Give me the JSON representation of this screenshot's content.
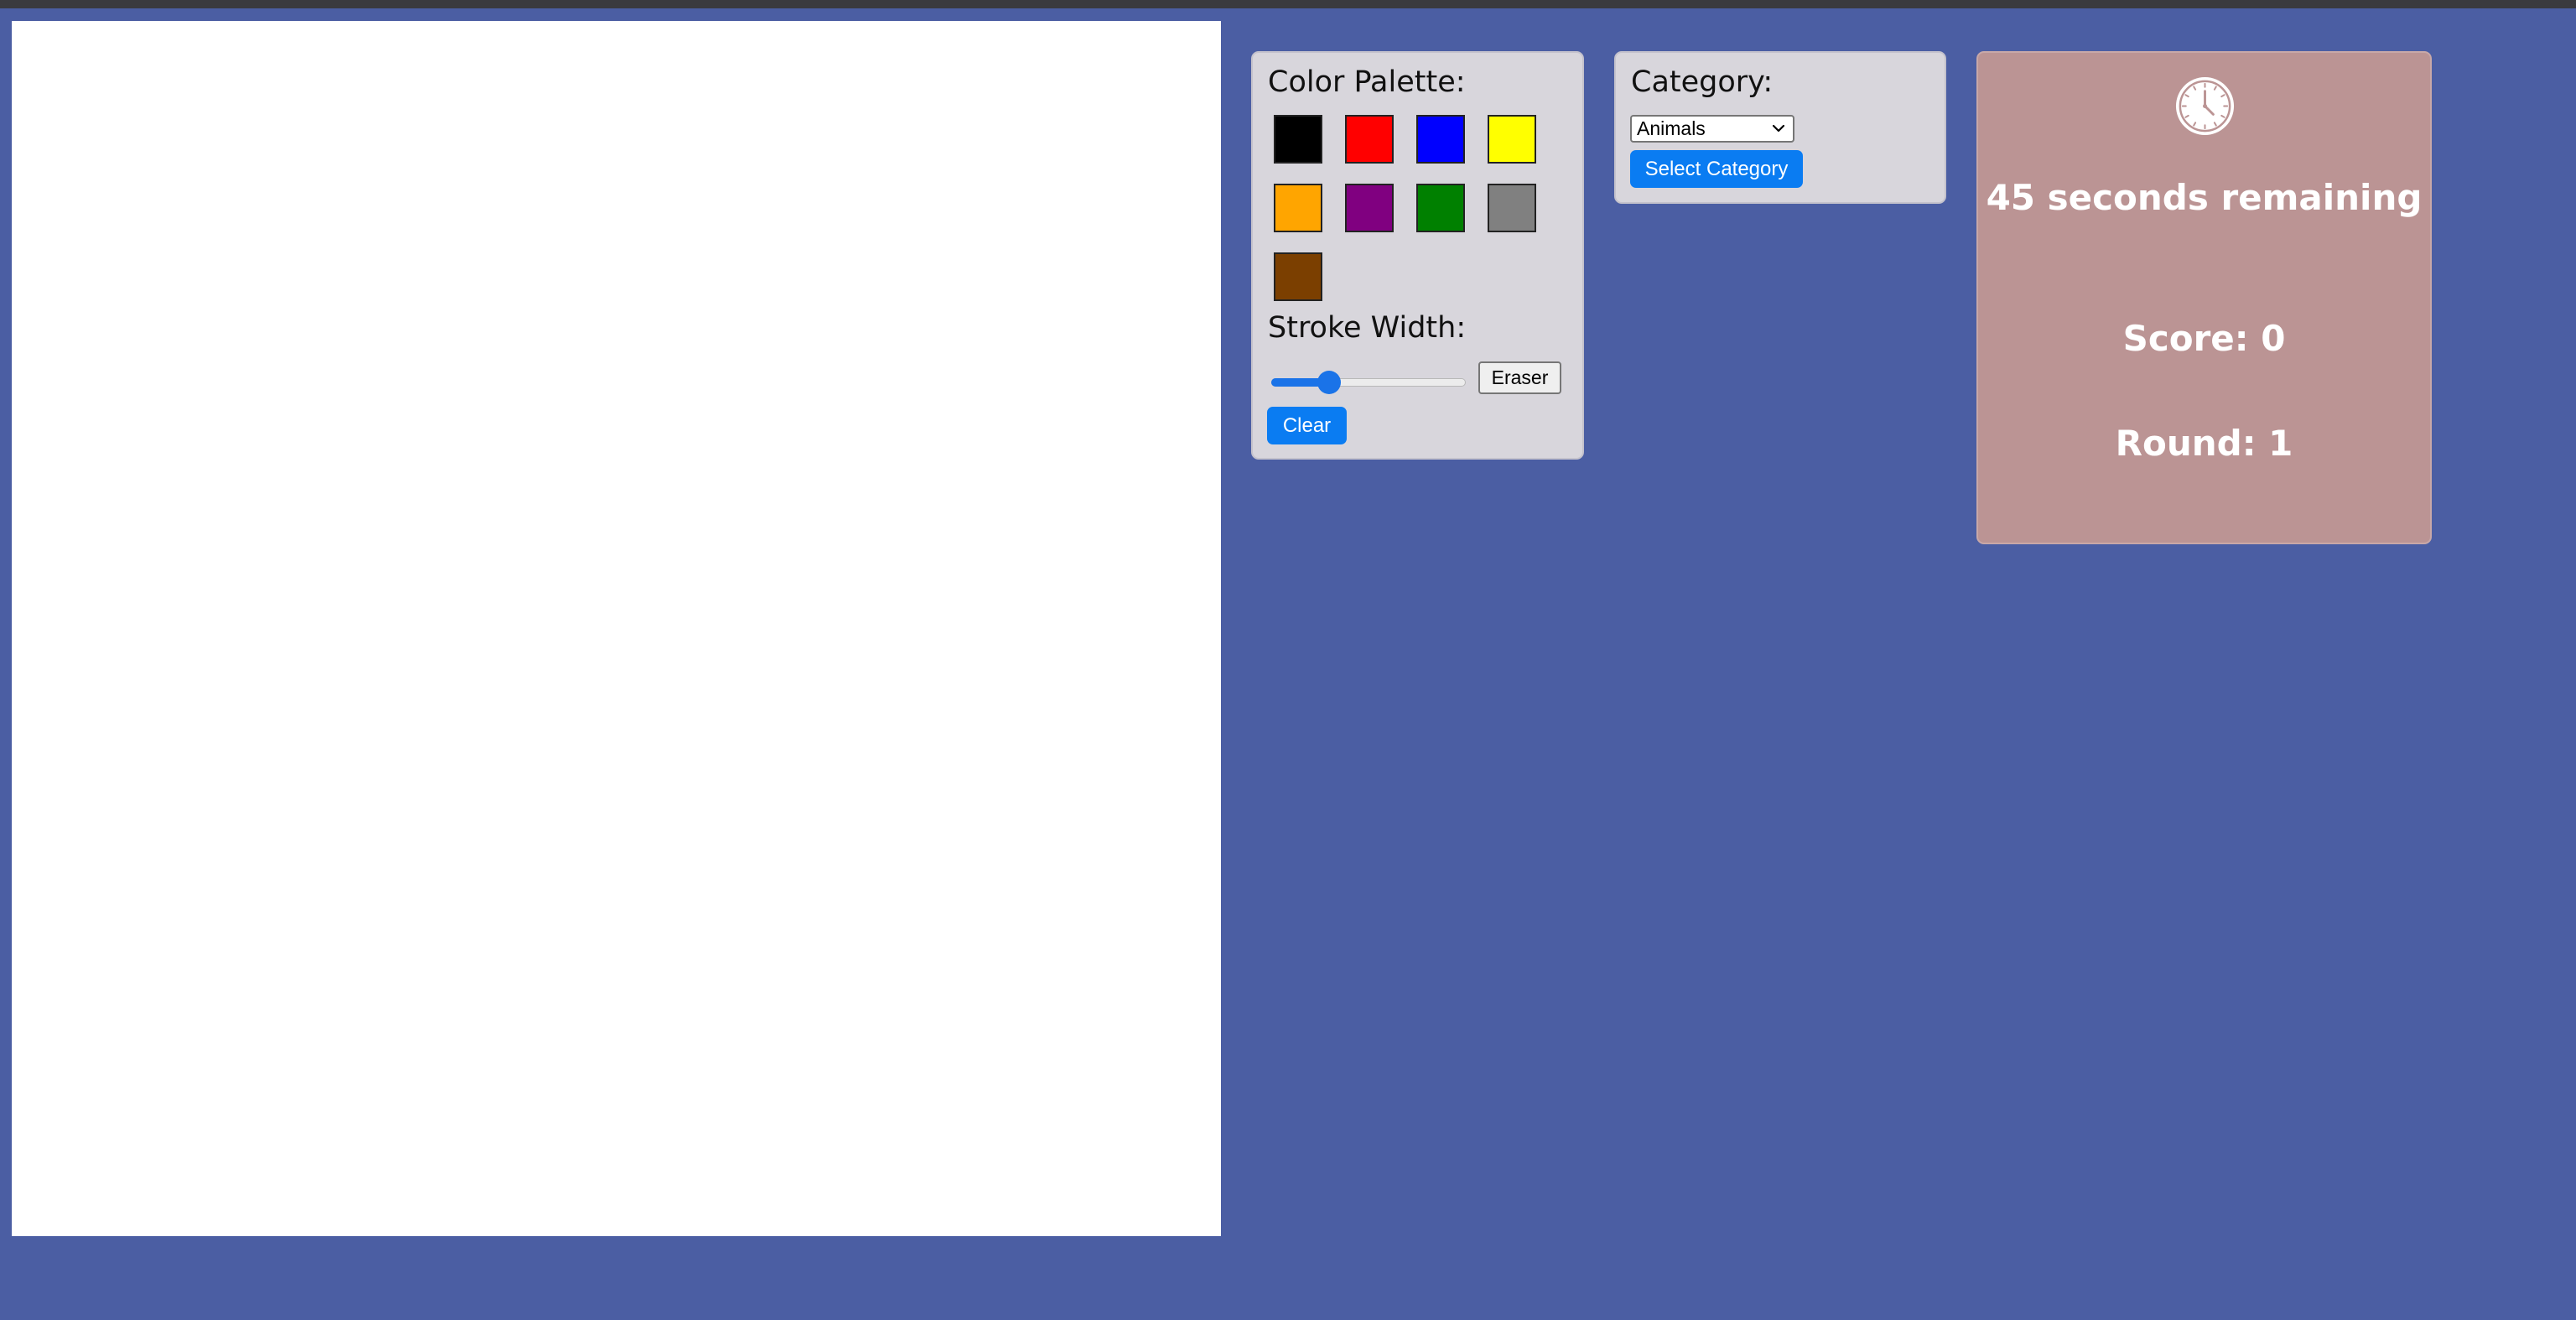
{
  "palette": {
    "title": "Color Palette:",
    "colors": [
      {
        "name": "black",
        "hex": "#000000"
      },
      {
        "name": "red",
        "hex": "#ff0000"
      },
      {
        "name": "blue",
        "hex": "#0000ff"
      },
      {
        "name": "yellow",
        "hex": "#ffff00"
      },
      {
        "name": "orange",
        "hex": "#ffa500"
      },
      {
        "name": "purple",
        "hex": "#800080"
      },
      {
        "name": "green",
        "hex": "#008000"
      },
      {
        "name": "gray",
        "hex": "#808080"
      },
      {
        "name": "brown",
        "hex": "#7b3f00"
      }
    ]
  },
  "stroke": {
    "title": "Stroke Width:",
    "value_fraction": 0.27
  },
  "buttons": {
    "eraser": "Eraser",
    "clear": "Clear",
    "select_category": "Select Category"
  },
  "category": {
    "title": "Category:",
    "selected": "Animals"
  },
  "game": {
    "timer_text": "45 seconds remaining",
    "score_text": "Score: 0",
    "round_text": "Round: 1"
  },
  "colors": {
    "background": "#4b5ea3",
    "panel": "#d8d6dc",
    "timer_panel": "#bb9494",
    "accent": "#0a7cf2"
  },
  "icons": {
    "timer": "clock-icon",
    "dropdown": "chevron-down-icon"
  }
}
